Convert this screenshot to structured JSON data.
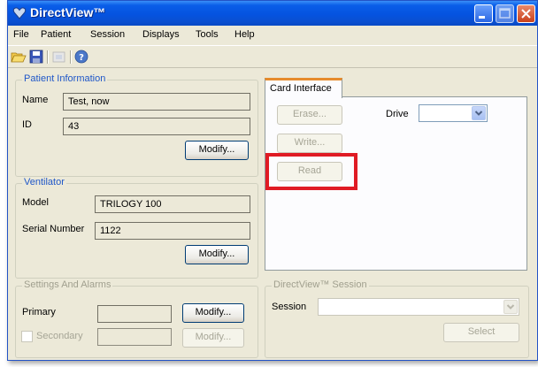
{
  "window": {
    "title": "DirectView™",
    "icons": {
      "app": "heart-app-icon",
      "minimize": "minimize-icon",
      "maximize": "maximize-icon",
      "close": "close-icon"
    }
  },
  "menu": [
    "File",
    "Patient",
    "Session",
    "Displays",
    "Tools",
    "Help"
  ],
  "toolbar": {
    "icons": [
      "open-folder-icon",
      "save-icon",
      "print-icon",
      "help-icon"
    ]
  },
  "patient": {
    "title": "Patient Information",
    "name_label": "Name",
    "name_value": "Test, now",
    "id_label": "ID",
    "id_value": "43",
    "modify_label": "Modify..."
  },
  "ventilator": {
    "title": "Ventilator",
    "model_label": "Model",
    "model_value": "TRILOGY 100",
    "serial_label": "Serial Number",
    "serial_value": "1122",
    "modify_label": "Modify..."
  },
  "settings": {
    "title": "Settings And Alarms",
    "primary_label": "Primary",
    "primary_value": "",
    "primary_modify": "Modify...",
    "secondary_label": "Secondary",
    "secondary_value": "",
    "secondary_modify": "Modify..."
  },
  "card": {
    "tab_label": "Card Interface",
    "erase_label": "Erase...",
    "write_label": "Write...",
    "read_label": "Read",
    "drive_label": "Drive",
    "drive_value": ""
  },
  "session": {
    "title": "DirectView™ Session",
    "session_label": "Session",
    "session_value": "",
    "select_label": "Select"
  },
  "colors": {
    "titlebar": "#0553e0",
    "group_title": "#1f57c8",
    "highlight": "#e01b24",
    "tab_accent": "#e68b2c"
  }
}
